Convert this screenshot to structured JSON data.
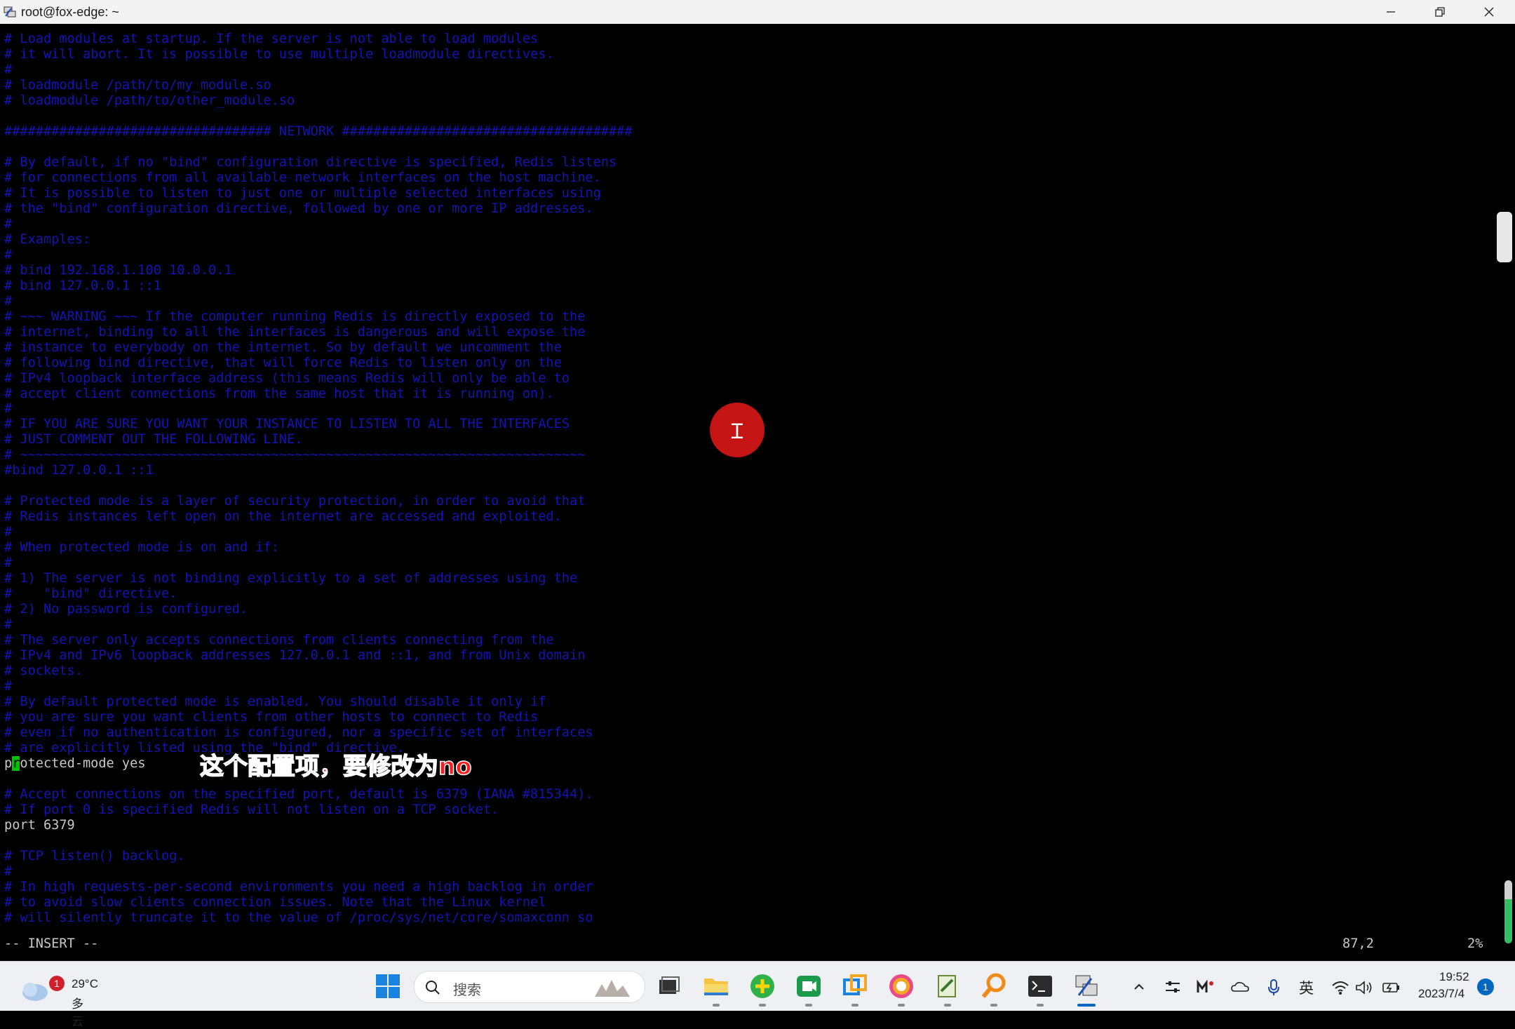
{
  "window": {
    "title": "root@fox-edge: ~"
  },
  "terminal": {
    "lines": [
      {
        "text": "# Load modules at startup. If the server is not able to load modules",
        "type": "comment"
      },
      {
        "text": "# it will abort. It is possible to use multiple loadmodule directives.",
        "type": "comment"
      },
      {
        "text": "#",
        "type": "comment"
      },
      {
        "text": "# loadmodule /path/to/my_module.so",
        "type": "comment"
      },
      {
        "text": "# loadmodule /path/to/other_module.so",
        "type": "comment"
      },
      {
        "text": "",
        "type": "blank"
      },
      {
        "text": "################################## NETWORK #####################################",
        "type": "comment"
      },
      {
        "text": "",
        "type": "blank"
      },
      {
        "text": "# By default, if no \"bind\" configuration directive is specified, Redis listens",
        "type": "comment"
      },
      {
        "text": "# for connections from all available network interfaces on the host machine.",
        "type": "comment"
      },
      {
        "text": "# It is possible to listen to just one or multiple selected interfaces using",
        "type": "comment"
      },
      {
        "text": "# the \"bind\" configuration directive, followed by one or more IP addresses.",
        "type": "comment"
      },
      {
        "text": "#",
        "type": "comment"
      },
      {
        "text": "# Examples:",
        "type": "comment"
      },
      {
        "text": "#",
        "type": "comment"
      },
      {
        "text": "# bind 192.168.1.100 10.0.0.1",
        "type": "comment"
      },
      {
        "text": "# bind 127.0.0.1 ::1",
        "type": "comment"
      },
      {
        "text": "#",
        "type": "comment"
      },
      {
        "text": "# ~~~ WARNING ~~~ If the computer running Redis is directly exposed to the",
        "type": "comment"
      },
      {
        "text": "# internet, binding to all the interfaces is dangerous and will expose the",
        "type": "comment"
      },
      {
        "text": "# instance to everybody on the internet. So by default we uncomment the",
        "type": "comment"
      },
      {
        "text": "# following bind directive, that will force Redis to listen only on the",
        "type": "comment"
      },
      {
        "text": "# IPv4 loopback interface address (this means Redis will only be able to",
        "type": "comment"
      },
      {
        "text": "# accept client connections from the same host that it is running on).",
        "type": "comment"
      },
      {
        "text": "#",
        "type": "comment"
      },
      {
        "text": "# IF YOU ARE SURE YOU WANT YOUR INSTANCE TO LISTEN TO ALL THE INTERFACES",
        "type": "comment"
      },
      {
        "text": "# JUST COMMENT OUT THE FOLLOWING LINE.",
        "type": "comment"
      },
      {
        "text": "# ~~~~~~~~~~~~~~~~~~~~~~~~~~~~~~~~~~~~~~~~~~~~~~~~~~~~~~~~~~~~~~~~~~~~~~~~",
        "type": "comment"
      },
      {
        "text": "#bind 127.0.0.1 ::1",
        "type": "comment"
      },
      {
        "text": "",
        "type": "blank"
      },
      {
        "text": "# Protected mode is a layer of security protection, in order to avoid that",
        "type": "comment"
      },
      {
        "text": "# Redis instances left open on the internet are accessed and exploited.",
        "type": "comment"
      },
      {
        "text": "#",
        "type": "comment"
      },
      {
        "text": "# When protected mode is on and if:",
        "type": "comment"
      },
      {
        "text": "#",
        "type": "comment"
      },
      {
        "text": "# 1) The server is not binding explicitly to a set of addresses using the",
        "type": "comment"
      },
      {
        "text": "#    \"bind\" directive.",
        "type": "comment"
      },
      {
        "text": "# 2) No password is configured.",
        "type": "comment"
      },
      {
        "text": "#",
        "type": "comment"
      },
      {
        "text": "# The server only accepts connections from clients connecting from the",
        "type": "comment"
      },
      {
        "text": "# IPv4 and IPv6 loopback addresses 127.0.0.1 and ::1, and from Unix domain",
        "type": "comment"
      },
      {
        "text": "# sockets.",
        "type": "comment"
      },
      {
        "text": "#",
        "type": "comment"
      },
      {
        "text": "# By default protected mode is enabled. You should disable it only if",
        "type": "comment"
      },
      {
        "text": "# you are sure you want clients from other hosts to connect to Redis",
        "type": "comment"
      },
      {
        "text": "# even if no authentication is configured, nor a specific set of interfaces",
        "type": "comment"
      },
      {
        "text": "# are explicitly listed using the \"bind\" directive.",
        "type": "comment"
      },
      {
        "text": "protected-mode yes",
        "type": "cursor"
      },
      {
        "text": "",
        "type": "blank"
      },
      {
        "text": "# Accept connections on the specified port, default is 6379 (IANA #815344).",
        "type": "comment"
      },
      {
        "text": "# If port 0 is specified Redis will not listen on a TCP socket.",
        "type": "comment"
      },
      {
        "text": "port 6379",
        "type": "normal"
      },
      {
        "text": "",
        "type": "blank"
      },
      {
        "text": "# TCP listen() backlog.",
        "type": "comment"
      },
      {
        "text": "#",
        "type": "comment"
      },
      {
        "text": "# In high requests-per-second environments you need a high backlog in order",
        "type": "comment"
      },
      {
        "text": "# to avoid slow clients connection issues. Note that the Linux kernel",
        "type": "comment"
      },
      {
        "text": "# will silently truncate it to the value of /proc/sys/net/core/somaxconn so",
        "type": "comment"
      }
    ],
    "cursor_line_prefix": "p",
    "cursor_char": "r",
    "cursor_line_rest": "otected-mode yes",
    "status_mode": "-- INSERT --",
    "status_position": "87,2",
    "status_percent": "2%",
    "subtitle": "这个配置项，要修改为no"
  },
  "taskbar": {
    "weather_temp": "29°C",
    "weather_desc": "多云",
    "weather_badge": "1",
    "search_placeholder": "搜索",
    "input_method": "英",
    "clock_time": "19:52",
    "clock_date": "2023/7/4",
    "notification_count": "1"
  }
}
